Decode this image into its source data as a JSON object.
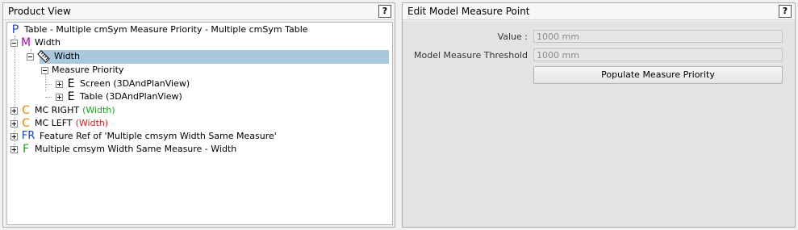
{
  "left_panel": {
    "title": "Product View",
    "help_label": "?",
    "tree": {
      "root": {
        "letter": "P",
        "label": "Table - Multiple cmSym Measure Priority - Multiple cmSym Table",
        "letter_color": "#1a3fd6"
      },
      "width_m": {
        "letter": "M",
        "label": "Width",
        "letter_color": "#b300b3"
      },
      "width_node": {
        "label": "Width",
        "icon": "measure-ruler-icon"
      },
      "measure_priority": {
        "label": "Measure Priority"
      },
      "screen": {
        "letter": "E",
        "label": "Screen (3DAndPlanView)"
      },
      "table": {
        "letter": "E",
        "label": "Table (3DAndPlanView)"
      },
      "mc_right": {
        "letter": "C",
        "label": "MC RIGHT",
        "suffix": "(Width)",
        "letter_color": "#e88a00",
        "suffix_color": "#22a022"
      },
      "mc_left": {
        "letter": "C",
        "label": "MC LEFT",
        "suffix": "(Width)",
        "letter_color": "#e88a00",
        "suffix_color": "#d02020"
      },
      "feature_ref": {
        "letter": "FR",
        "label": "Feature Ref of 'Multiple cmsym Width Same Measure'",
        "letter_color": "#1a3fd6"
      },
      "feature": {
        "letter": "F",
        "label": "Multiple cmsym Width Same Measure - Width",
        "letter_color": "#20a020"
      }
    }
  },
  "right_panel": {
    "title": "Edit Model Measure Point",
    "help_label": "?",
    "value_label": "Value :",
    "value": "1000 mm",
    "threshold_label": "Model Measure Threshold",
    "threshold_value": "1000 mm",
    "populate_button": "Populate Measure Priority"
  }
}
